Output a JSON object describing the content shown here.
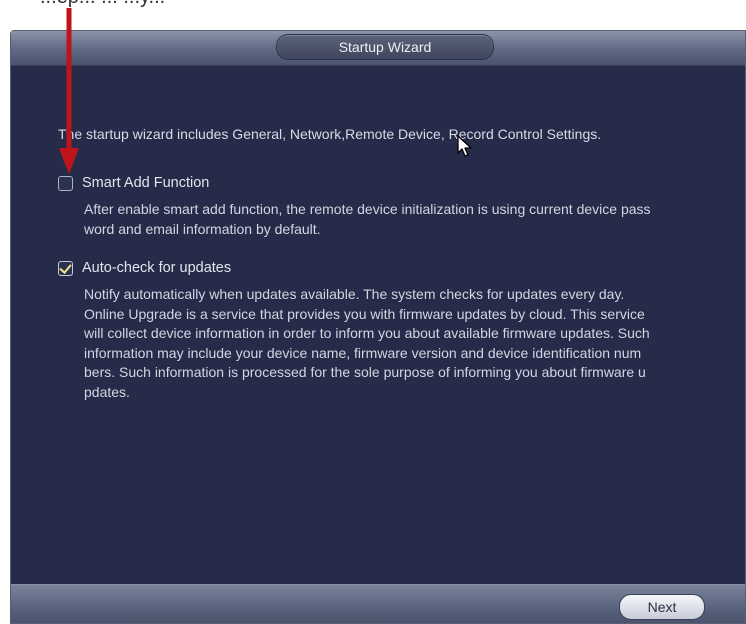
{
  "caption_fragment": "...ep... ... ...y...",
  "window": {
    "title": "Startup Wizard",
    "intro": "The startup wizard includes General, Network,Remote Device, Record Control Settings.",
    "options": [
      {
        "label": "Smart Add Function",
        "checked": false,
        "description": "After enable smart add function, the remote device initialization is using current device pass\nword and email information by default."
      },
      {
        "label": "Auto-check for updates",
        "checked": true,
        "description": "Notify automatically when updates available. The system checks for updates every day.\nOnline Upgrade is a service that provides you with firmware updates by cloud. This service\nwill collect device information in order to inform you about available firmware updates. Such\n information may include your device name, firmware version and device identification num\nbers. Such information is processed for the sole purpose of informing you about firmware u\npdates."
      }
    ],
    "next_label": "Next"
  },
  "colors": {
    "background": "#252b48",
    "text": "#d8dbe6",
    "annotation_arrow": "#c0141c",
    "checkmark": "#f0e68c"
  },
  "icons": [
    "mouse-cursor-icon",
    "red-arrow-annotation",
    "checkbox-unchecked-icon",
    "checkbox-checked-icon"
  ]
}
